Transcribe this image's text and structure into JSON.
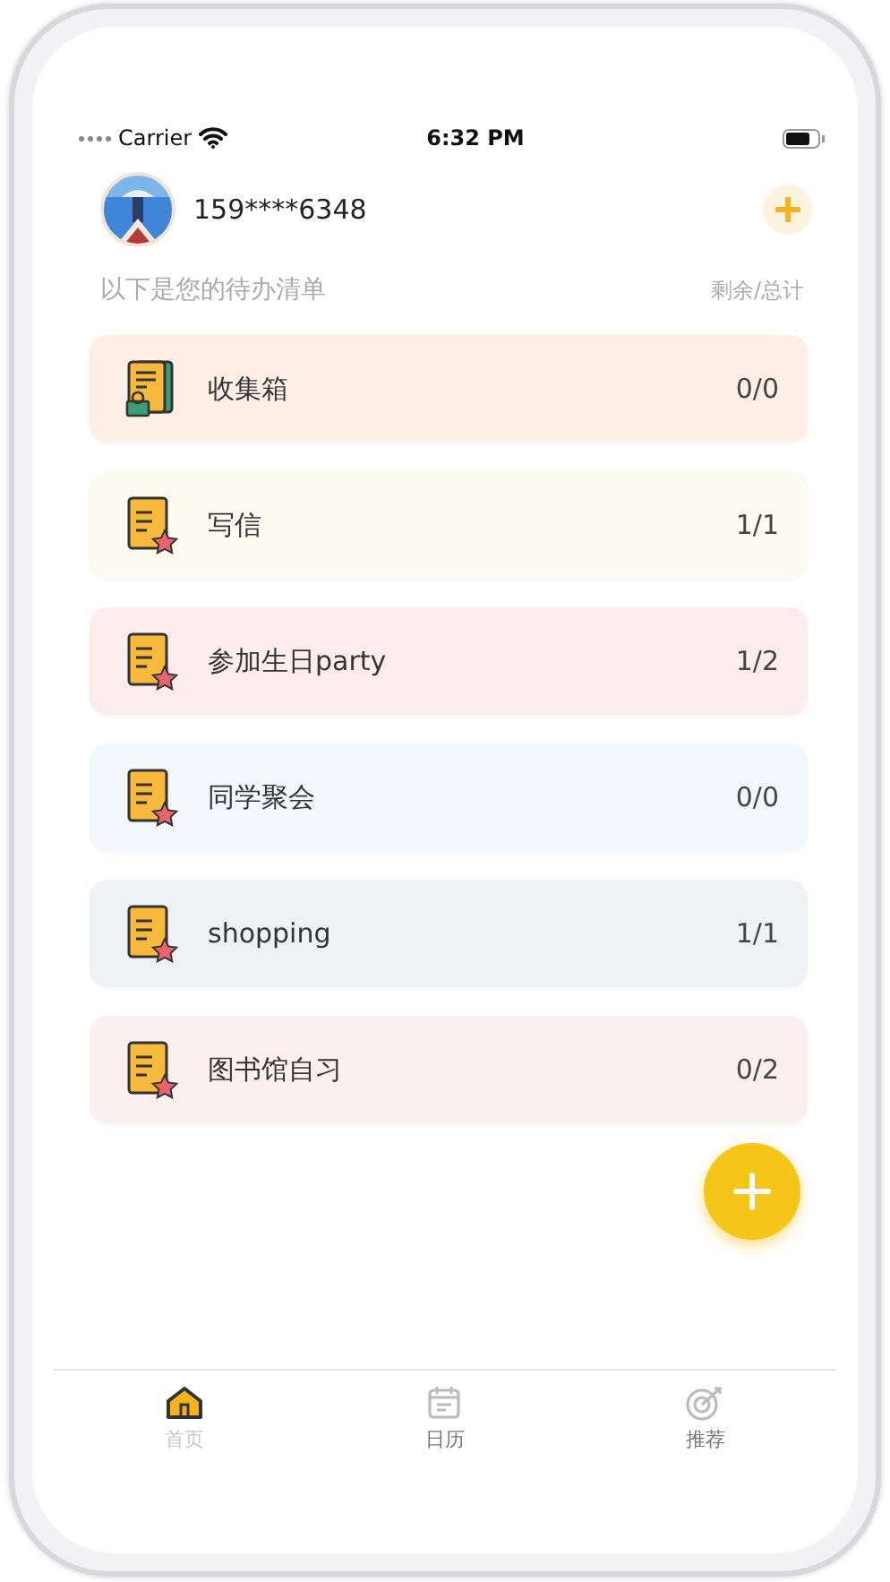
{
  "status_bar": {
    "carrier": "Carrier",
    "time": "6:32 PM"
  },
  "header": {
    "username": "159****6348"
  },
  "list_title": "以下是您的待办清单",
  "list_hint": "剩余/总计",
  "lists": [
    {
      "kind": "inbox",
      "name": "收集箱",
      "count": "0/0",
      "color": "#fdeee6"
    },
    {
      "kind": "note",
      "name": "写信",
      "count": "1/1",
      "color": "#fdfaef"
    },
    {
      "kind": "note",
      "name": "参加生日party",
      "count": "1/2",
      "color": "#fcecec"
    },
    {
      "kind": "note",
      "name": "同学聚会",
      "count": "0/0",
      "color": "#f2f7fb"
    },
    {
      "kind": "note",
      "name": "shopping",
      "count": "1/1",
      "color": "#eef2f5"
    },
    {
      "kind": "note",
      "name": "图书馆自习",
      "count": "0/2",
      "color": "#fbf0ef"
    }
  ],
  "tabs": [
    {
      "kind": "home",
      "label": "首页",
      "selected": true
    },
    {
      "kind": "calendar",
      "label": "日历",
      "selected": false
    },
    {
      "kind": "target",
      "label": "推荐",
      "selected": false
    }
  ]
}
